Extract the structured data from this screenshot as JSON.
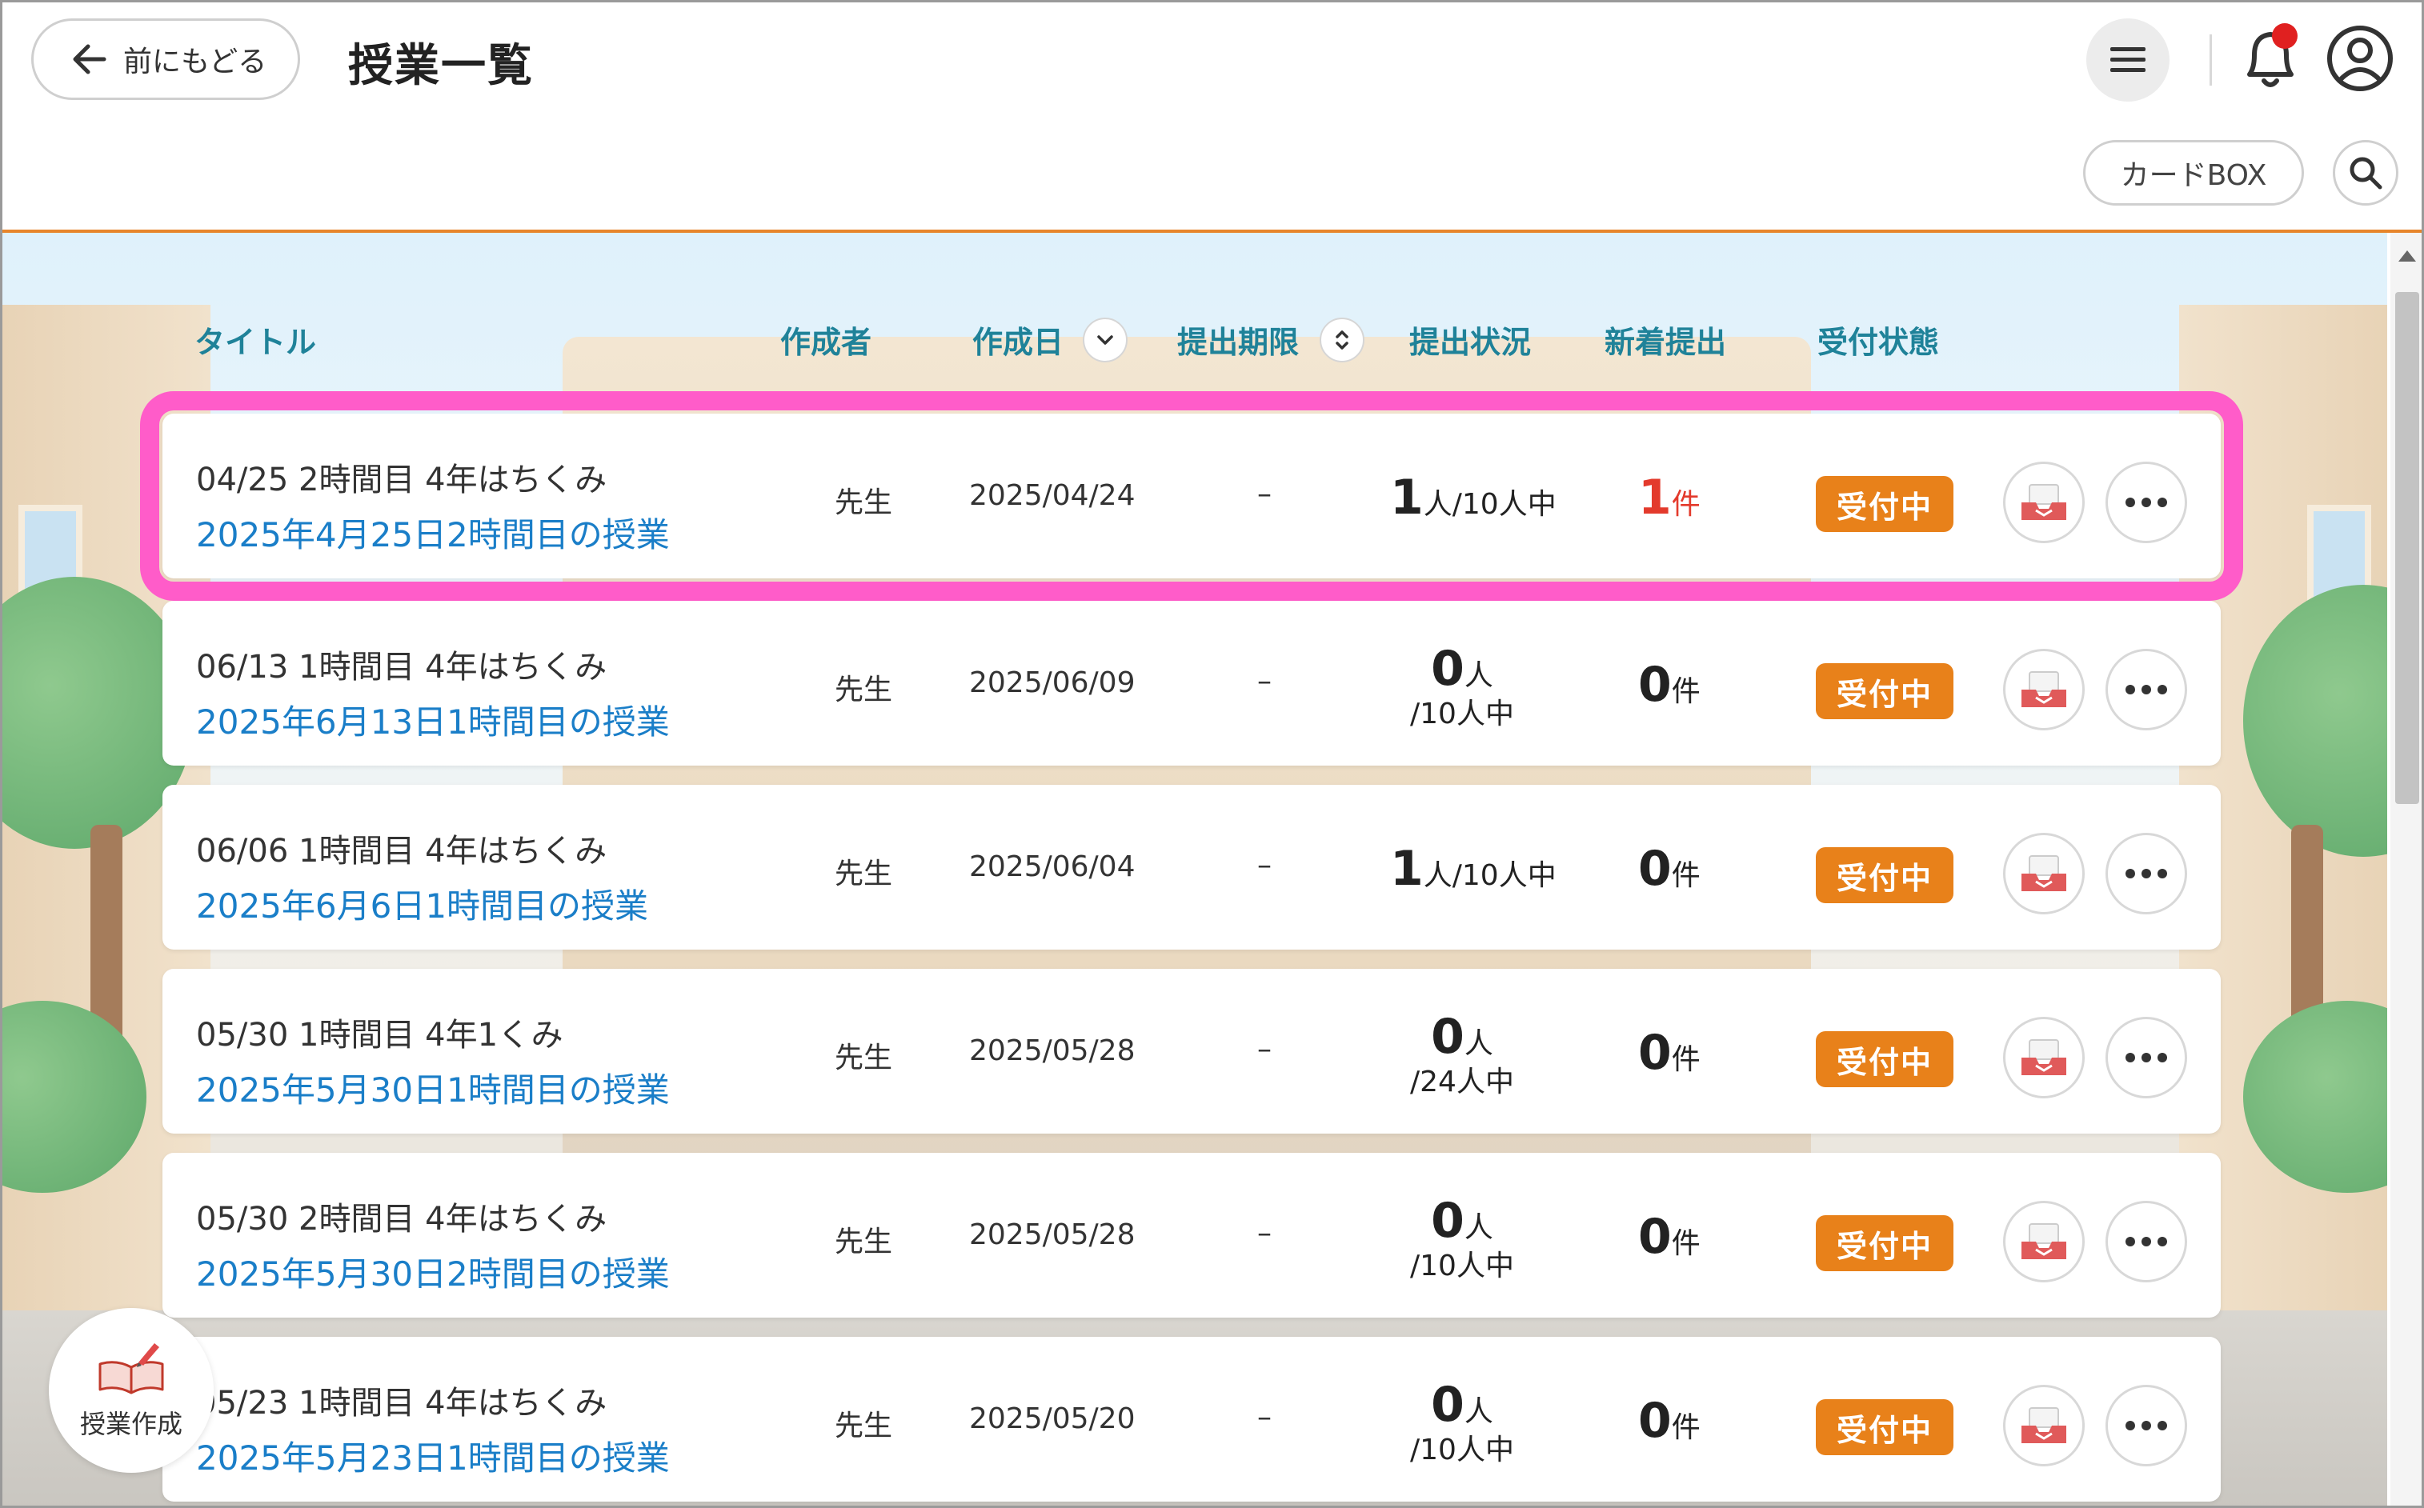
{
  "header": {
    "back_label": "前にもどる",
    "page_title": "授業一覧",
    "cardbox_label": "カードBOX"
  },
  "columns": {
    "title": "タイトル",
    "creator": "作成者",
    "created": "作成日",
    "deadline": "提出期限",
    "status": "提出状況",
    "new": "新着提出",
    "accept": "受付状態"
  },
  "rows": [
    {
      "line1": "04/25 2時間目 4年はちくみ",
      "line2": "2025年4月25日2時間目の授業",
      "creator": "先生",
      "date": "2025/04/24",
      "deadline": "–",
      "sub_count": "1",
      "sub_unit": "人",
      "sub_total": "/10人中",
      "new_count": "1",
      "new_unit": "件",
      "badge": "受付中"
    },
    {
      "line1": "06/13 1時間目 4年はちくみ",
      "line2": "2025年6月13日1時間目の授業",
      "creator": "先生",
      "date": "2025/06/09",
      "deadline": "–",
      "sub_count": "0",
      "sub_unit": "人",
      "sub_total": "/10人中",
      "new_count": "0",
      "new_unit": "件",
      "badge": "受付中"
    },
    {
      "line1": "06/06 1時間目 4年はちくみ",
      "line2": "2025年6月6日1時間目の授業",
      "creator": "先生",
      "date": "2025/06/04",
      "deadline": "–",
      "sub_count": "1",
      "sub_unit": "人",
      "sub_total": "/10人中",
      "new_count": "0",
      "new_unit": "件",
      "badge": "受付中"
    },
    {
      "line1": "05/30 1時間目 4年1くみ",
      "line2": "2025年5月30日1時間目の授業",
      "creator": "先生",
      "date": "2025/05/28",
      "deadline": "–",
      "sub_count": "0",
      "sub_unit": "人",
      "sub_total": "/24人中",
      "new_count": "0",
      "new_unit": "件",
      "badge": "受付中"
    },
    {
      "line1": "05/30 2時間目 4年はちくみ",
      "line2": "2025年5月30日2時間目の授業",
      "creator": "先生",
      "date": "2025/05/28",
      "deadline": "–",
      "sub_count": "0",
      "sub_unit": "人",
      "sub_total": "/10人中",
      "new_count": "0",
      "new_unit": "件",
      "badge": "受付中"
    },
    {
      "line1": "05/23 1時間目 4年はちくみ",
      "line2": "2025年5月23日1時間目の授業",
      "creator": "先生",
      "date": "2025/05/20",
      "deadline": "–",
      "sub_count": "0",
      "sub_unit": "人",
      "sub_total": "/10人中",
      "new_count": "0",
      "new_unit": "件",
      "badge": "受付中"
    }
  ],
  "create_button_label": "授業作成",
  "icons": {
    "back": "arrow-left-icon",
    "menu": "hamburger-menu-icon",
    "bell": "bell-icon",
    "user": "user-account-icon",
    "search": "search-icon",
    "inbox": "inbox-tray-icon",
    "more": "more-horizontal-icon",
    "create": "book-pencil-icon"
  },
  "colors": {
    "accent_orange": "#e8811a",
    "header_rule": "#e7852b",
    "highlight": "#ff5cc9",
    "link_blue": "#1a7ec8",
    "column_teal": "#1f8299",
    "new_red": "#e33a2c",
    "notification_dot": "#e02020"
  }
}
